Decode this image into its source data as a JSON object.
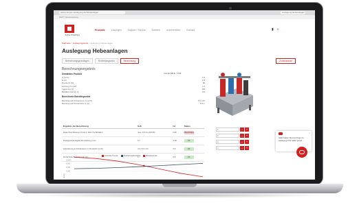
{
  "browser": {
    "url": "www.pumpen-auslegung.de/hebeanlagen",
    "tab_right": "Auslegung Hebeanlagen"
  },
  "top_strip": "DEPT Niederlassung",
  "brand": {
    "logo_text": "JUNG PUMPEN",
    "accent_color": "#d4211f"
  },
  "nav": {
    "items": [
      "Produkte",
      "Lösungen",
      "Support / Service",
      "Karriere",
      "Unternehmen",
      "Kontakt"
    ],
    "active_index": 0
  },
  "header_icons": [
    "document-icon",
    "search-icon"
  ],
  "breadcrumb": {
    "home": "Startseite",
    "sep1": ">",
    "mid": "Auslegungstools",
    "sep2": ">",
    "current": "Auslegung Hebeanlagen"
  },
  "page_title": "Auslegung Hebeanlagen",
  "tabs": [
    "Berechnungsgrundlagen",
    "Rohrleitungsnetz",
    "Berechnung"
  ],
  "active_tab_index": 2,
  "tab_right_button": "Zurücksetzen",
  "results": {
    "section_title": "Berechnungsergebnis",
    "product_title": "Gewähltes Produkt",
    "product_name": "Compli 400 E / 1700",
    "spec_rows": [
      {
        "label": "Q (m³/h)",
        "value": "6,5"
      },
      {
        "label": "H (m)",
        "value": "6,8"
      },
      {
        "label": "Druckrohr DN",
        "value": "80"
      },
      {
        "label": "Leistung P1 (kW)",
        "value": "2,1"
      },
      {
        "label": "Spannung (V)",
        "value": "400"
      },
      {
        "label": "Behältervolumen (l)",
        "value": "170"
      }
    ],
    "calc_title": "Berechnete Betriebspunkte",
    "calc_rows": [
      {
        "label": "Betriebspunkt Förderstrom Q (m³/h)",
        "value": "6,5 m³/h"
      },
      {
        "label": "Betriebspunkt Förderhöhe H (m)",
        "value": "6,8 m"
      }
    ]
  },
  "table": {
    "headers": [
      "Ergebnis der Berechnung",
      "Soll",
      "Ist",
      "Status"
    ],
    "rows": [
      {
        "label": "Zulauf Durchfluss an Punkt in Rohr (l/s Behälter)",
        "soll": "max. 0,8 m/s (DN 80)",
        "ist": "0,82",
        "status": "Überschritten",
        "ok": false
      },
      {
        "label": "Fließgeschwindigkeit Druckleitung (m/s)",
        "soll": "0,7",
        "ist": "0,96",
        "status": "OK",
        "ok": true
      },
      {
        "label": "Anforderung an Förderstrom im Druckrohr (m³/h)",
        "soll": "min. 6,0 m³/h",
        "ist": "6,5",
        "status": "OK",
        "ok": true
      },
      {
        "label": "Förderhöhe Betriebspunkt (m)",
        "soll": "6",
        "ist": "6,8",
        "status": "OK",
        "ok": true
      }
    ]
  },
  "right_inputs": [
    {
      "value": "1",
      "minus": "–",
      "plus": "+"
    },
    {
      "value": "2",
      "minus": "–",
      "plus": "+"
    },
    {
      "value": "3",
      "minus": "–",
      "plus": "+"
    },
    {
      "value": "4",
      "minus": "–",
      "plus": "+"
    }
  ],
  "chat": {
    "text": "Hallo! Haben Sie eine Frage zur Auslegung? Wir helfen gerne!",
    "close": "×"
  },
  "chart_data": {
    "type": "line",
    "title": "",
    "xlabel": "",
    "ylabel": "H (m)",
    "ylim": [
      0,
      12
    ],
    "xlim": [
      0,
      12
    ],
    "yticks": [
      "10,000",
      "8,000",
      "6,000",
      "4,000"
    ],
    "legend_position": "top",
    "series": [
      {
        "name": "Kennlinie Pumpe",
        "color": "#d4211f",
        "x": [
          0,
          2,
          4,
          6,
          8,
          10,
          12
        ],
        "y": [
          11.5,
          10.8,
          9.4,
          7.4,
          5.0,
          2.6,
          0.8
        ]
      },
      {
        "name": "Rohrleitungskennlinie",
        "color": "#3b4f63",
        "x": [
          0,
          2,
          4,
          6,
          8,
          10,
          12
        ],
        "y": [
          5.2,
          5.4,
          5.8,
          6.3,
          6.9,
          7.5,
          8.1
        ]
      },
      {
        "name": "Betriebspunkt",
        "color": "#c8231f",
        "x": [
          6.5
        ],
        "y": [
          6.8
        ]
      }
    ]
  }
}
